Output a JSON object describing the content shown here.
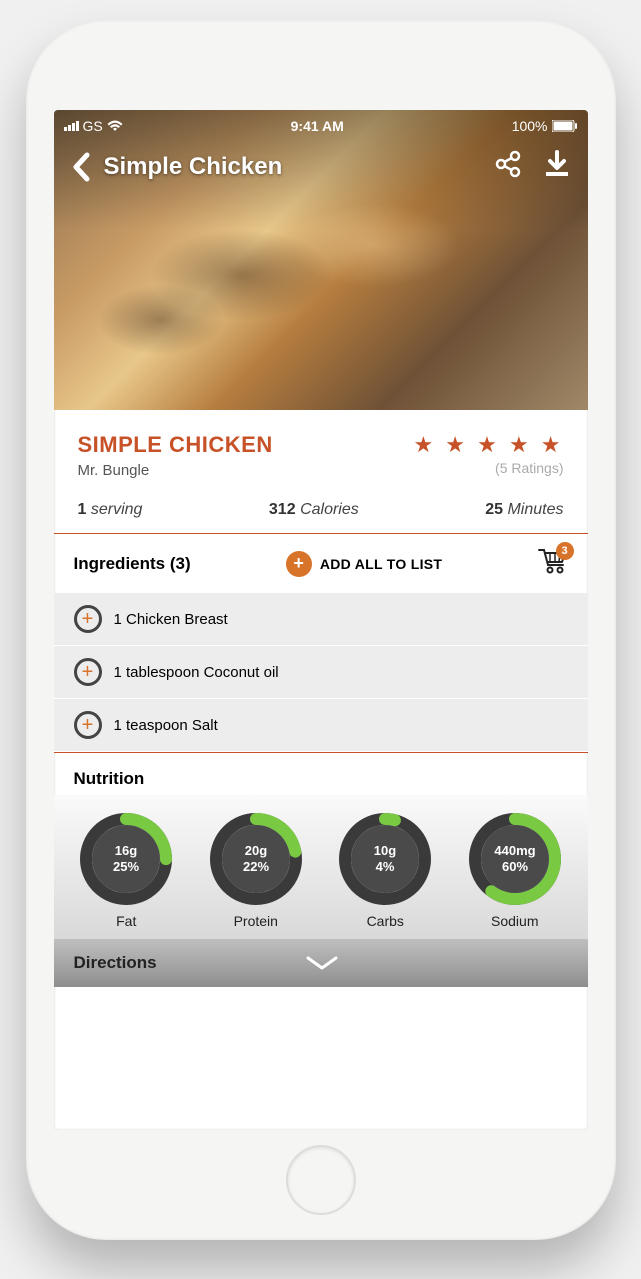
{
  "status": {
    "carrier": "GS",
    "time": "9:41 AM",
    "battery": "100%"
  },
  "hero": {
    "title": "Simple Chicken"
  },
  "recipe": {
    "title": "SIMPLE CHICKEN",
    "author": "Mr. Bungle",
    "stars": "★ ★ ★ ★ ★",
    "ratings_label": "(5 Ratings)",
    "serving_value": "1",
    "serving_label": "serving",
    "calories_value": "312",
    "calories_label": "Calories",
    "time_value": "25",
    "time_label": "Minutes"
  },
  "ingredients": {
    "heading": "Ingredients (3)",
    "add_all_label": "ADD ALL TO LIST",
    "cart_count": "3",
    "items": [
      {
        "text": "1 Chicken Breast"
      },
      {
        "text": "1 tablespoon Coconut oil"
      },
      {
        "text": "1 teaspoon Salt"
      }
    ]
  },
  "nutrition": {
    "heading": "Nutrition",
    "items": [
      {
        "amount": "16g",
        "percent": "25%",
        "label": "Fat",
        "arc": 0.25
      },
      {
        "amount": "20g",
        "percent": "22%",
        "label": "Protein",
        "arc": 0.22
      },
      {
        "amount": "10g",
        "percent": "4%",
        "label": "Carbs",
        "arc": 0.04
      },
      {
        "amount": "440mg",
        "percent": "60%",
        "label": "Sodium",
        "arc": 0.6
      }
    ]
  },
  "directions": {
    "heading": "Directions"
  }
}
